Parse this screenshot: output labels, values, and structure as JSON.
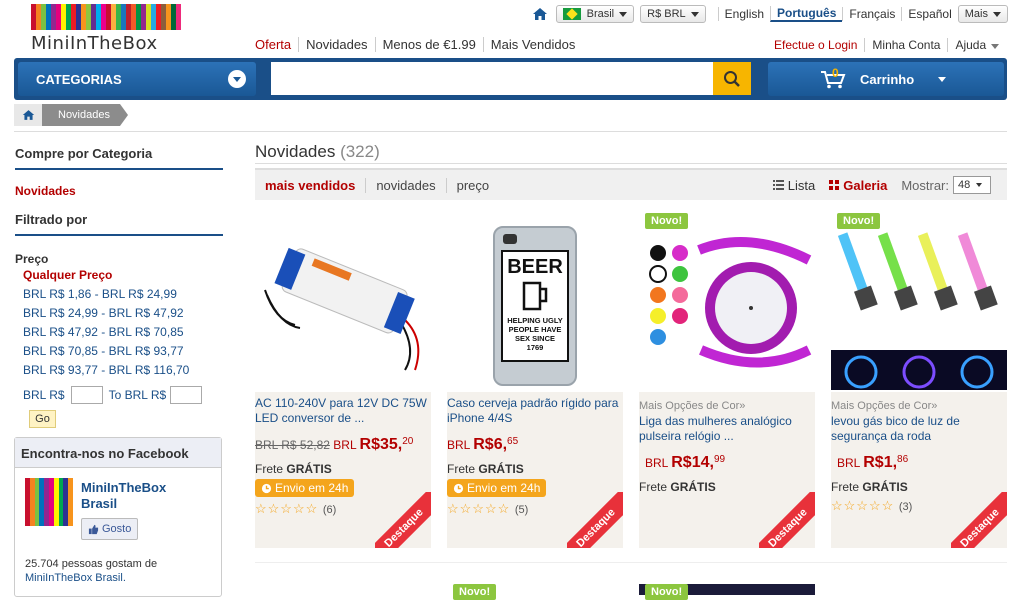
{
  "brand": {
    "name": "MiniInTheBox"
  },
  "topbar": {
    "country": "Brasil",
    "currency": "R$ BRL",
    "languages": [
      "English",
      "Português",
      "Français",
      "Español"
    ],
    "more": "Mais"
  },
  "nav": {
    "links": [
      "Oferta",
      "Novidades",
      "Menos de €1.99",
      "Mais Vendidos"
    ]
  },
  "account": {
    "login": "Efectue o Login",
    "my_account": "Minha Conta",
    "help": "Ajuda"
  },
  "header": {
    "categories": "CATEGORIAS",
    "cart": "Carrinho",
    "cart_count": "0"
  },
  "breadcrumb": {
    "current": "Novidades"
  },
  "sidebar": {
    "shop_by": "Compre por Categoria",
    "active_cat": "Novidades",
    "filtered_by": "Filtrado por",
    "price_label": "Preço",
    "any_price": "Qualquer Preço",
    "ranges": [
      "BRL R$ 1,86 - BRL R$ 24,99",
      "BRL R$ 24,99 - BRL R$ 47,92",
      "BRL R$ 47,92 - BRL R$ 70,85",
      "BRL R$ 70,85 - BRL R$ 93,77",
      "BRL R$ 93,77 - BRL R$ 116,70"
    ],
    "from_label": "BRL R$",
    "to_label": "To BRL R$",
    "go": "Go"
  },
  "facebook": {
    "title": "Encontra-nos no Facebook",
    "page_name": "MiniInTheBox Brasil",
    "like": "Gosto",
    "fans": "25.704 pessoas gostam de",
    "fans_link": "MiniInTheBox Brasil."
  },
  "main": {
    "title": "Novidades",
    "count": "(322)",
    "sorts": [
      "mais vendidos",
      "novidades",
      "preço"
    ],
    "view_list": "Lista",
    "view_gallery": "Galeria",
    "show_label": "Mostrar:",
    "show_value": "48"
  },
  "products": [
    {
      "name": "AC 110-240V para 12V DC 75W LED conversor de ...",
      "old_price": "BRL R$ 52,82",
      "cur": "BRL",
      "price": "R$35,",
      "cents": "20",
      "frete": "Frete",
      "gratis": "GRÁTIS",
      "envio": "Envio em 24h",
      "reviews": "(6)",
      "ribbon": "Destaque"
    },
    {
      "name": "Caso cerveja padrão rígido para iPhone 4/4S",
      "cur": "BRL",
      "price": "R$6,",
      "cents": "65",
      "frete": "Frete",
      "gratis": "GRÁTIS",
      "envio": "Envio em 24h",
      "reviews": "(5)",
      "ribbon": "Destaque",
      "case_text1": "BEER",
      "case_text2": "HELPING UGLY PEOPLE HAVE SEX SINCE 1769"
    },
    {
      "options": "Mais Opções de Cor»",
      "name": "Liga das mulheres analógico pulseira relógio ...",
      "cur": "BRL",
      "price": "R$14,",
      "cents": "99",
      "frete": "Frete",
      "gratis": "GRÁTIS",
      "ribbon": "Destaque",
      "novo": "Novo!"
    },
    {
      "options": "Mais Opções de Cor»",
      "name": "levou gás bico de luz de segurança da roda",
      "cur": "BRL",
      "price": "R$1,",
      "cents": "86",
      "frete": "Frete",
      "gratis": "GRÁTIS",
      "reviews": "(3)",
      "ribbon": "Destaque",
      "novo": "Novo!"
    }
  ],
  "extra": {
    "novo": "Novo!"
  }
}
